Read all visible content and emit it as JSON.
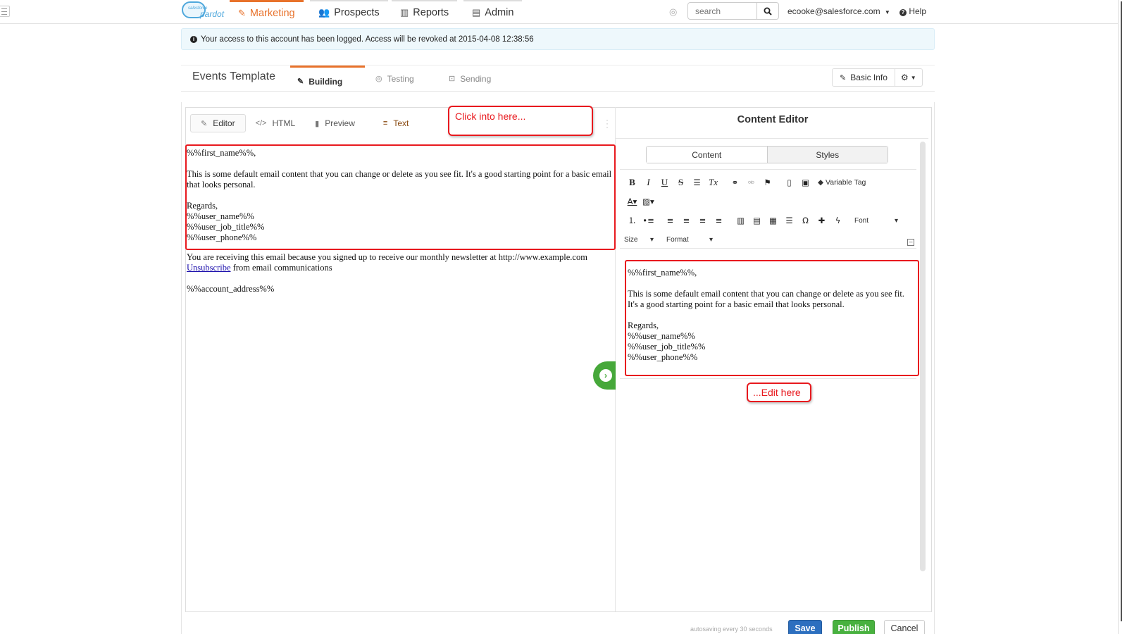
{
  "nav": {
    "logo_top": "salesforce",
    "logo_word": "pardot",
    "tabs": [
      {
        "label": "Marketing",
        "icon": "pencil-icon",
        "active": true
      },
      {
        "label": "Prospects",
        "icon": "users-icon",
        "active": false
      },
      {
        "label": "Reports",
        "icon": "bar-chart-icon",
        "active": false
      },
      {
        "label": "Admin",
        "icon": "briefcase-icon",
        "active": false
      }
    ],
    "search_placeholder": "search",
    "user": "ecooke@salesforce.com",
    "help": "Help"
  },
  "alert": {
    "text": "Your access to this account has been logged. Access will be revoked at 2015-04-08 12:38:56"
  },
  "template": {
    "title": "Events Template",
    "stages": [
      "Building",
      "Testing",
      "Sending"
    ],
    "basic_info": "Basic Info"
  },
  "editor": {
    "tabs": [
      "Editor",
      "HTML",
      "Preview",
      "Text"
    ],
    "content": [
      "%%first_name%%,",
      "",
      "This is some default email content that you can change or delete as you see fit. It's a good starting point for a basic email that looks personal.",
      "",
      "Regards,",
      "%%user_name%%",
      "%%user_job_title%%",
      "%%user_phone%%"
    ],
    "footer_line1": "You are receiving this email because you signed up to receive our monthly newsletter at http://www.example.com",
    "unsubscribe": "Unsubscribe",
    "unsubscribe_rest": " from email communications",
    "account_address": "%%account_address%%"
  },
  "annotations": {
    "click_into": "Click into here...",
    "edit_here": "...Edit here"
  },
  "content_editor": {
    "title": "Content Editor",
    "tabs": [
      "Content",
      "Styles"
    ],
    "variable_tag": "Variable Tag",
    "font": "Font",
    "size": "Size",
    "format": "Format",
    "content": [
      "%%first_name%%,",
      "",
      "This is some default email content that you can change or delete as you see fit. It's a good starting point for a basic email that looks personal.",
      "",
      "Regards,",
      "%%user_name%%",
      "%%user_job_title%%",
      "%%user_phone%%"
    ]
  },
  "footer": {
    "autosave": "autosaving every 30 seconds",
    "save": "Save",
    "publish": "Publish",
    "cancel": "Cancel"
  },
  "colors": {
    "accent": "#e8722b",
    "annotation_red": "#e8191e",
    "save_blue": "#2c6fbf",
    "publish_green": "#48b13f"
  }
}
